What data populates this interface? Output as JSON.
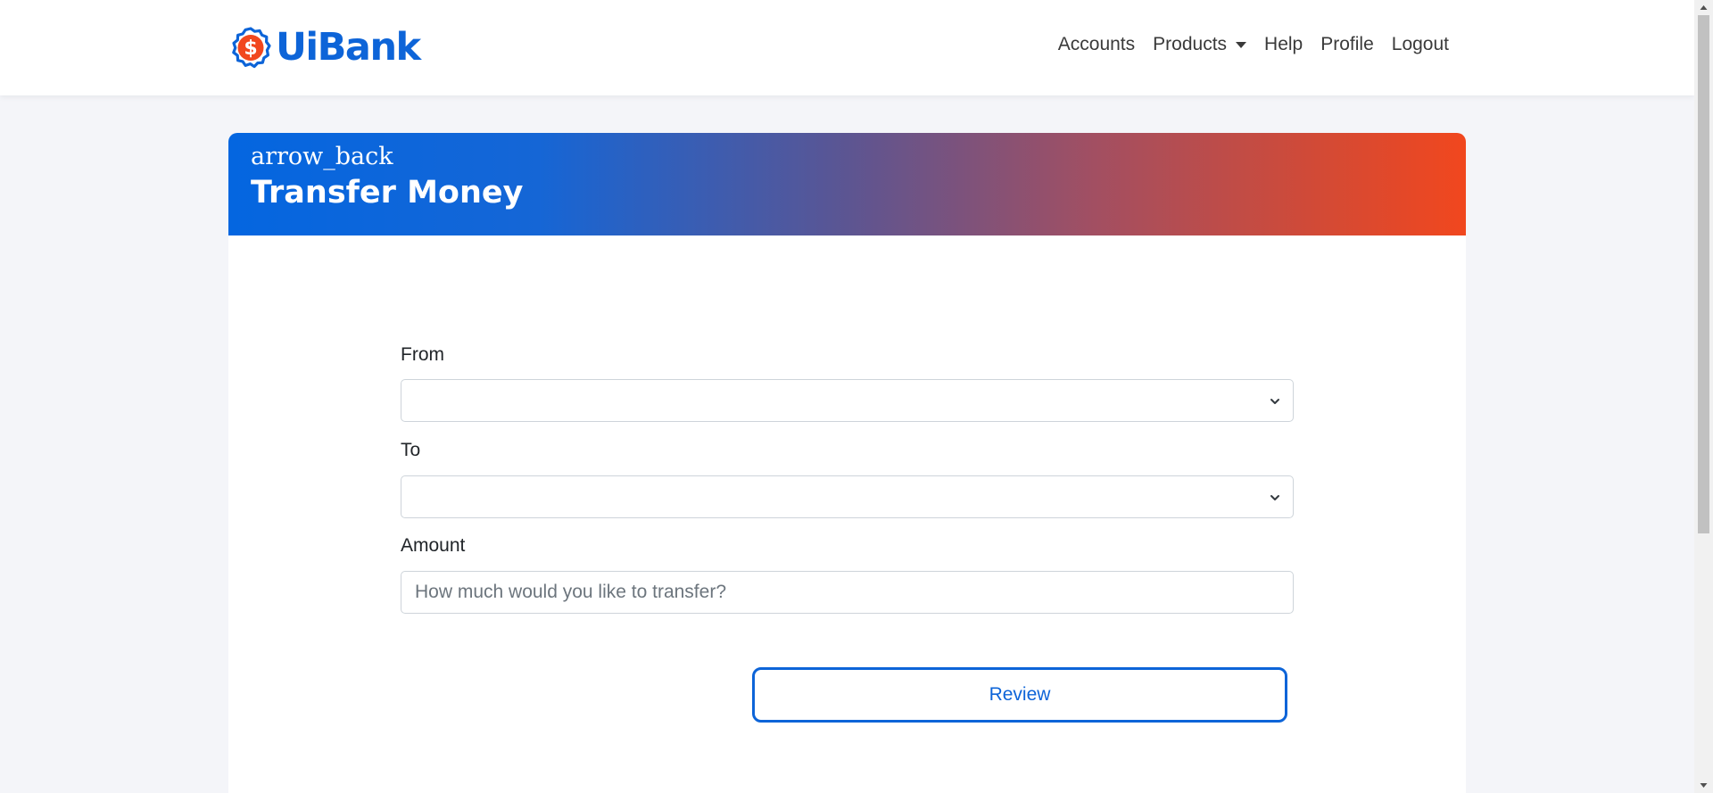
{
  "brand": {
    "name": "UiBank",
    "accent": "#0d64d8",
    "icon_accent": "#f1471e"
  },
  "nav": {
    "items": [
      {
        "label": "Accounts"
      },
      {
        "label": "Products",
        "has_dropdown": true
      },
      {
        "label": "Help"
      },
      {
        "label": "Profile"
      },
      {
        "label": "Logout"
      }
    ]
  },
  "card": {
    "back_label": "arrow_back",
    "title": "Transfer Money",
    "gradient": [
      "#0466e0",
      "#f1471e"
    ]
  },
  "form": {
    "from_label": "From",
    "from_value": "",
    "to_label": "To",
    "to_value": "",
    "amount_label": "Amount",
    "amount_value": "",
    "amount_placeholder": "How much would you like to transfer?",
    "review_label": "Review"
  }
}
